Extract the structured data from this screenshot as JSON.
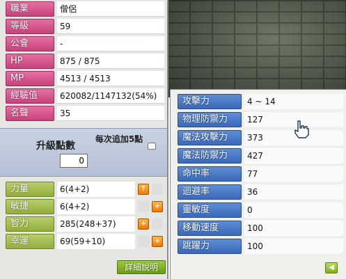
{
  "basic": {
    "rows": [
      {
        "label": "職業",
        "value": "僧侶"
      },
      {
        "label": "等級",
        "value": "59"
      },
      {
        "label": "公會",
        "value": "-"
      },
      {
        "label": "HP",
        "value": "875 / 875"
      },
      {
        "label": "MP",
        "value": "4513 / 4513"
      },
      {
        "label": "經驗值",
        "value": "620082/1147132(54%)"
      },
      {
        "label": "名聲",
        "value": "35"
      }
    ]
  },
  "ability_points": {
    "label": "升級點數",
    "value": "0",
    "note": "每次追加5點"
  },
  "stats": [
    {
      "label": "力量",
      "value": "6(4+2)"
    },
    {
      "label": "敏捷",
      "value": "6(4+2)"
    },
    {
      "label": "智力",
      "value": "285(248+37)"
    },
    {
      "label": "幸運",
      "value": "69(59+10)"
    }
  ],
  "detail_button": "詳細說明",
  "details": [
    {
      "label": "攻擊力",
      "value": "4 ~ 14"
    },
    {
      "label": "物理防禦力",
      "value": "127"
    },
    {
      "label": "魔法攻擊力",
      "value": "373"
    },
    {
      "label": "魔法防禦力",
      "value": "427"
    },
    {
      "label": "命中率",
      "value": "77"
    },
    {
      "label": "迴避率",
      "value": "36"
    },
    {
      "label": "靈敏度",
      "value": "0"
    },
    {
      "label": "移動速度",
      "value": "100"
    },
    {
      "label": "跳躍力",
      "value": "100"
    }
  ],
  "icons": {
    "plus": "plus-icon",
    "back": "back-arrow-icon",
    "cursor": "hand-cursor-icon"
  },
  "colors": {
    "basic_label": "#d9558e",
    "stat_label": "#a6bf52",
    "detail_label": "#4b7cc9",
    "plus_button": "#f58a12"
  }
}
